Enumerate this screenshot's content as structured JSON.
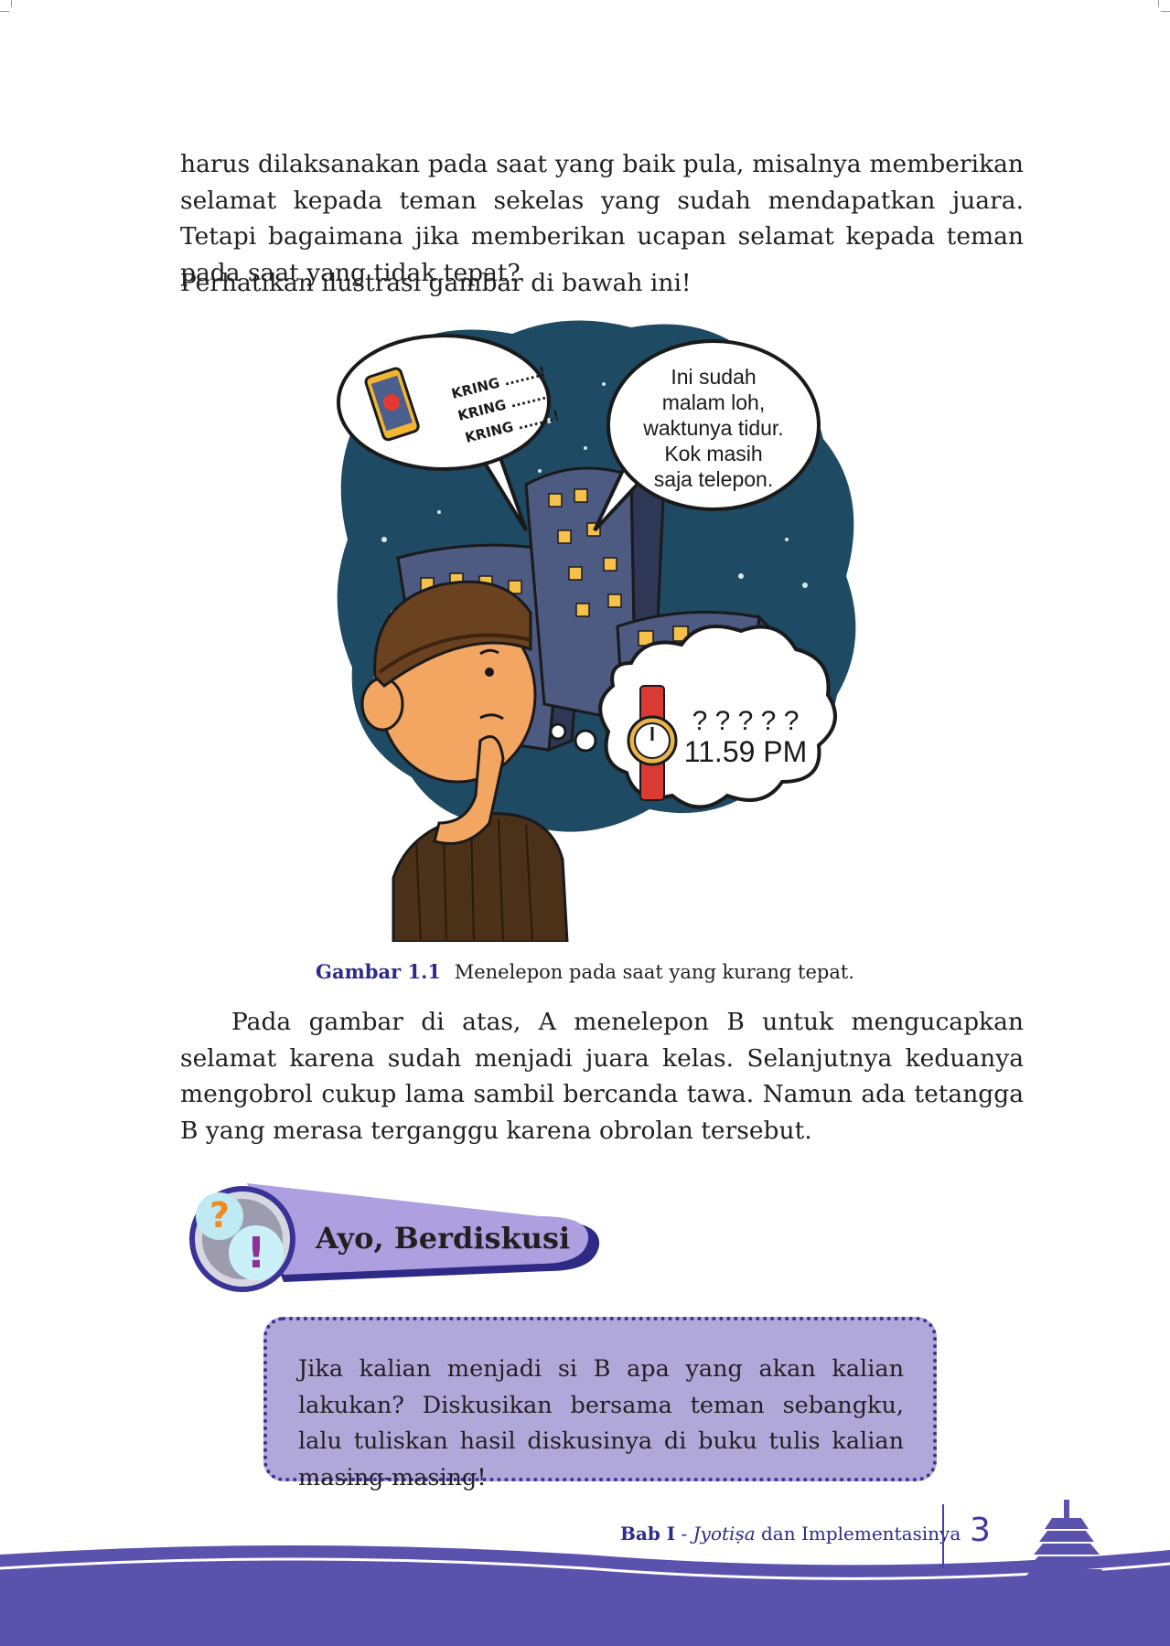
{
  "body": {
    "paragraph_1": "harus dilaksanakan pada saat yang baik pula, misalnya memberikan selamat kepada teman sekelas yang sudah mendapatkan juara. Tetapi bagaimana jika memberikan ucapan selamat kepada teman pada saat yang tidak tepat?",
    "paragraph_2": "Perhatikan ilustrasi gambar di bawah ini!",
    "paragraph_3": "Pada gambar di atas, A menelepon B untuk mengucapkan selamat karena sudah menjadi juara kelas. Selanjutnya keduanya mengobrol cukup lama sambil bercanda tawa. Namun ada tetangga B yang merasa terganggu karena obrolan tersebut."
  },
  "illustration": {
    "phone_bubble": [
      "KRING .......!",
      "KRING .......!",
      "KRING .......!"
    ],
    "speech_bubble": [
      "Ini sudah",
      "malam loh,",
      "waktunya tidur.",
      "Kok masih",
      "saja telepon."
    ],
    "thought_question": "? ? ? ? ?",
    "thought_time": "11.59 PM"
  },
  "caption": {
    "label": "Gambar 1.1",
    "text": "Menelepon pada saat yang kurang tepat."
  },
  "discussion": {
    "title": "Ayo, Berdiskusi",
    "text": "Jika kalian menjadi si B apa yang akan kalian lakukan? Diskusikan bersama teman sebangku, lalu tuliskan hasil diskusinya di buku tulis kalian masing-masing!",
    "icons": [
      "question-mark-icon",
      "exclamation-mark-icon"
    ]
  },
  "footer": {
    "chapter": "Bab I",
    "separator": " - ",
    "topic": "Jyotiṣa",
    "rest": " dan Implementasinya",
    "page_number": "3"
  },
  "colors": {
    "accent": "#2d2a8c",
    "box_fill": "#b1a8da",
    "footer_purple": "#5b52ad",
    "night_sky": "#1e4a63"
  }
}
